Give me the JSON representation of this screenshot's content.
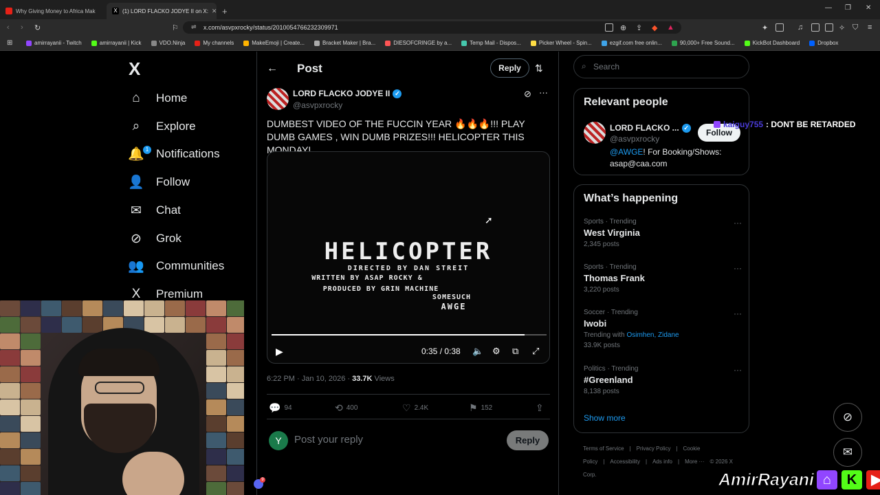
{
  "browser": {
    "tabs": [
      {
        "label": "Why Giving Money to Africa Mak",
        "color": "#e62117"
      },
      {
        "label": "(1) LORD FLACKO JODYE II on X:",
        "color": "#e7e9ea"
      }
    ],
    "new_tab": "+",
    "url": "x.com/asvpxrocky/status/2010054766232309971",
    "bookmarks": [
      {
        "label": "amirrayanii - Twitch",
        "color": "#9146ff"
      },
      {
        "label": "amirrayanii | Kick",
        "color": "#53fc18"
      },
      {
        "label": "VDO.Ninja",
        "color": "#888888"
      },
      {
        "label": "My channels",
        "color": "#e62117"
      },
      {
        "label": "MakeEmoji | Create...",
        "color": "#ffb400"
      },
      {
        "label": "Bracket Maker | Bra...",
        "color": "#aaaaaa"
      },
      {
        "label": "DIESOFCRINGE by a...",
        "color": "#ff5555"
      },
      {
        "label": "Temp Mail - Dispos...",
        "color": "#46c8ad"
      },
      {
        "label": "Picker Wheel - Spin...",
        "color": "#ffdd44"
      },
      {
        "label": "ezgif.com free onlin...",
        "color": "#3fa4e8"
      },
      {
        "label": "90,000+ Free Sound...",
        "color": "#2ea44f"
      },
      {
        "label": "KickBot Dashboard",
        "color": "#53fc18"
      },
      {
        "label": "Dropbox",
        "color": "#0061ff"
      }
    ]
  },
  "sidebar": {
    "logo": "X",
    "items": [
      {
        "label": "Home",
        "icon": "⌂"
      },
      {
        "label": "Explore",
        "icon": "⌕"
      },
      {
        "label": "Notifications",
        "icon": "🔔",
        "badge": "1"
      },
      {
        "label": "Follow",
        "icon": "👤"
      },
      {
        "label": "Chat",
        "icon": "✉"
      },
      {
        "label": "Grok",
        "icon": "⊘"
      },
      {
        "label": "Communities",
        "icon": "👥"
      },
      {
        "label": "Premium",
        "icon": "X"
      }
    ]
  },
  "main": {
    "title": "Post",
    "reply_button": "Reply",
    "author": {
      "name": "LORD FLACKO JODYE II",
      "handle": "@asvpxrocky"
    },
    "text": "DUMBEST VIDEO OF THE FUCCIN YEAR 🔥🔥🔥!!! PLAY DUMB GAMES , WIN DUMB PRIZES!!! HELICOPTER THIS MONDAY!",
    "video": {
      "title": "HELICOPTER",
      "line1": "DIRECTED BY DAN STREIT",
      "line2": "WRITTEN BY ASAP ROCKY &",
      "line3": "PRODUCED BY  GRIN MACHINE",
      "line4": "SOMESUCH",
      "line5": "AWGE",
      "time": "0:35 / 0:38",
      "progress": 0.92
    },
    "meta": {
      "time": "6:22 PM · Jan 10, 2026 · ",
      "views": "33.7K",
      "views_label": " Views"
    },
    "actions": {
      "replies": "94",
      "reposts": "400",
      "likes": "2.4K",
      "bookmarks": "152"
    },
    "reply_box": {
      "avatar": "Y",
      "placeholder": "Post your reply",
      "button": "Reply"
    }
  },
  "right": {
    "search_placeholder": "Search",
    "relevant": {
      "title": "Relevant people",
      "name": "LORD FLACKO ...",
      "handle": "@asvpxrocky",
      "follow": "Follow",
      "bio_link": "@AWGE",
      "bio_text": "! For Booking/Shows: asap@caa.com"
    },
    "happening": {
      "title": "What’s happening",
      "trends": [
        {
          "category": "Sports · Trending",
          "name": "West Virginia",
          "posts": "2,345 posts"
        },
        {
          "category": "Sports · Trending",
          "name": "Thomas Frank",
          "posts": "3,220 posts"
        },
        {
          "category": "Soccer · Trending",
          "name": "Iwobi",
          "with_label": "Trending with ",
          "with": "Osimhen, Zidane",
          "posts": "33.9K posts"
        },
        {
          "category": "Politics · Trending",
          "name": "#Greenland",
          "posts": "8,138 posts"
        }
      ],
      "show_more": "Show more"
    },
    "footer": [
      "Terms of Service",
      "|",
      "Privacy Policy",
      "|",
      "Cookie Policy",
      "|",
      "Accessibility",
      "|",
      "Ads info",
      "|",
      "More ···",
      "© 2026 X Corp."
    ]
  },
  "overlay": {
    "chat_user": "kaiguy755",
    "chat_msg": ": DONT BE RETARDED",
    "logo_text": "AmirRayani",
    "discord_badge": "9"
  }
}
